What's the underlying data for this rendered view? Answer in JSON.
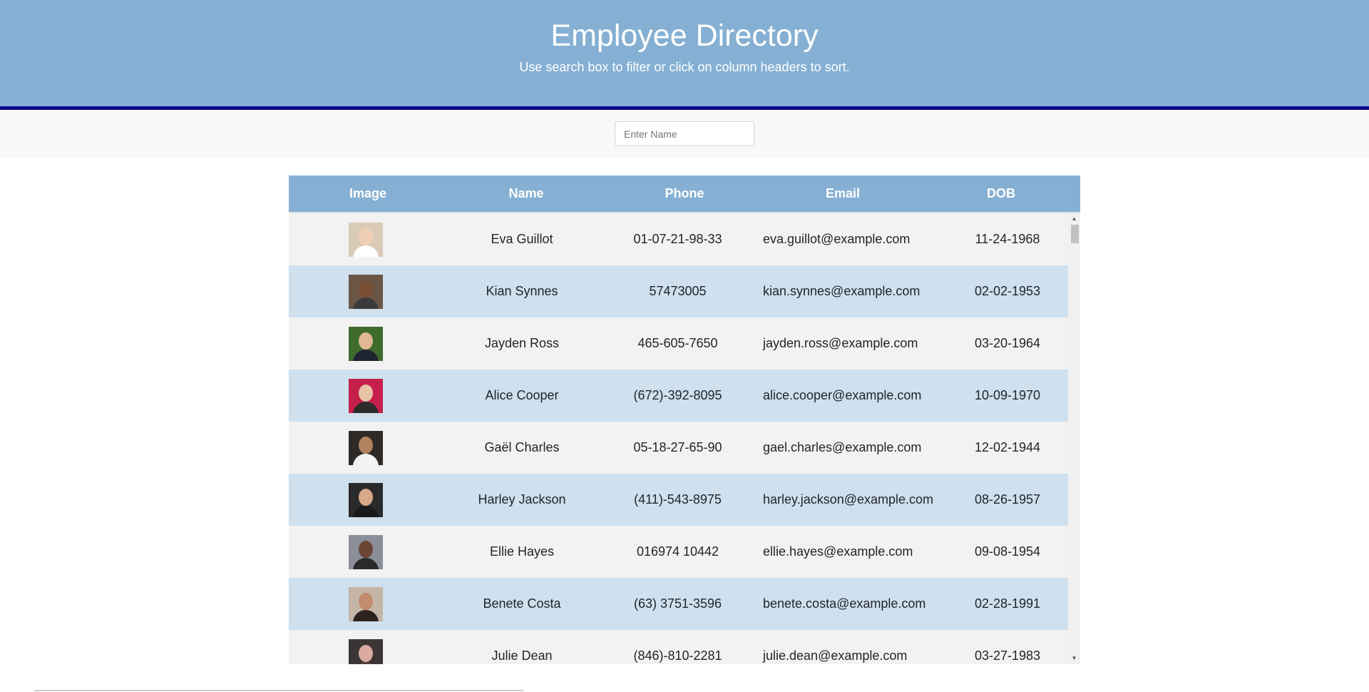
{
  "header": {
    "title": "Employee Directory",
    "subtitle": "Use search box to filter or click on column headers to sort."
  },
  "search": {
    "placeholder": "Enter Name",
    "value": ""
  },
  "table": {
    "columns": [
      "Image",
      "Name",
      "Phone",
      "Email",
      "DOB"
    ],
    "rows": [
      {
        "name": "Eva Guillot",
        "phone": "01-07-21-98-33",
        "email": "eva.guillot@example.com",
        "dob": "11-24-1968",
        "avatar": {
          "bg": "#d9cbb8",
          "face": "#f0cfb5",
          "body": "#ffffff"
        }
      },
      {
        "name": "Kian Synnes",
        "phone": "57473005",
        "email": "kian.synnes@example.com",
        "dob": "02-02-1953",
        "avatar": {
          "bg": "#6b5646",
          "face": "#7a4e34",
          "body": "#3a3a3a"
        }
      },
      {
        "name": "Jayden Ross",
        "phone": "465-605-7650",
        "email": "jayden.ross@example.com",
        "dob": "03-20-1964",
        "avatar": {
          "bg": "#3f6a2e",
          "face": "#e0b896",
          "body": "#1f2433"
        }
      },
      {
        "name": "Alice Cooper",
        "phone": "(672)-392-8095",
        "email": "alice.cooper@example.com",
        "dob": "10-09-1970",
        "avatar": {
          "bg": "#c61f4b",
          "face": "#e8c3a8",
          "body": "#2b2b2b"
        }
      },
      {
        "name": "Gaël Charles",
        "phone": "05-18-27-65-90",
        "email": "gael.charles@example.com",
        "dob": "12-02-1944",
        "avatar": {
          "bg": "#2e2a27",
          "face": "#b2835f",
          "body": "#f4f4f4"
        }
      },
      {
        "name": "Harley Jackson",
        "phone": "(411)-543-8975",
        "email": "harley.jackson@example.com",
        "dob": "08-26-1957",
        "avatar": {
          "bg": "#2a2a2a",
          "face": "#d7a98a",
          "body": "#1a1a1a"
        }
      },
      {
        "name": "Ellie Hayes",
        "phone": "016974 10442",
        "email": "ellie.hayes@example.com",
        "dob": "09-08-1954",
        "avatar": {
          "bg": "#8a8f99",
          "face": "#6b4633",
          "body": "#2a2a2a"
        }
      },
      {
        "name": "Benete Costa",
        "phone": "(63) 3751-3596",
        "email": "benete.costa@example.com",
        "dob": "02-28-1991",
        "avatar": {
          "bg": "#c4b5a6",
          "face": "#c38b6e",
          "body": "#2e2220"
        }
      },
      {
        "name": "Julie Dean",
        "phone": "(846)-810-2281",
        "email": "julie.dean@example.com",
        "dob": "03-27-1983",
        "avatar": {
          "bg": "#3b3535",
          "face": "#d9a9a2",
          "body": "#5a3f3a"
        }
      }
    ]
  },
  "colors": {
    "header_bg": "#85b0d3",
    "header_border": "#0a0a8a",
    "row_odd": "#f2f2f2",
    "row_even": "#cfe0ee"
  }
}
